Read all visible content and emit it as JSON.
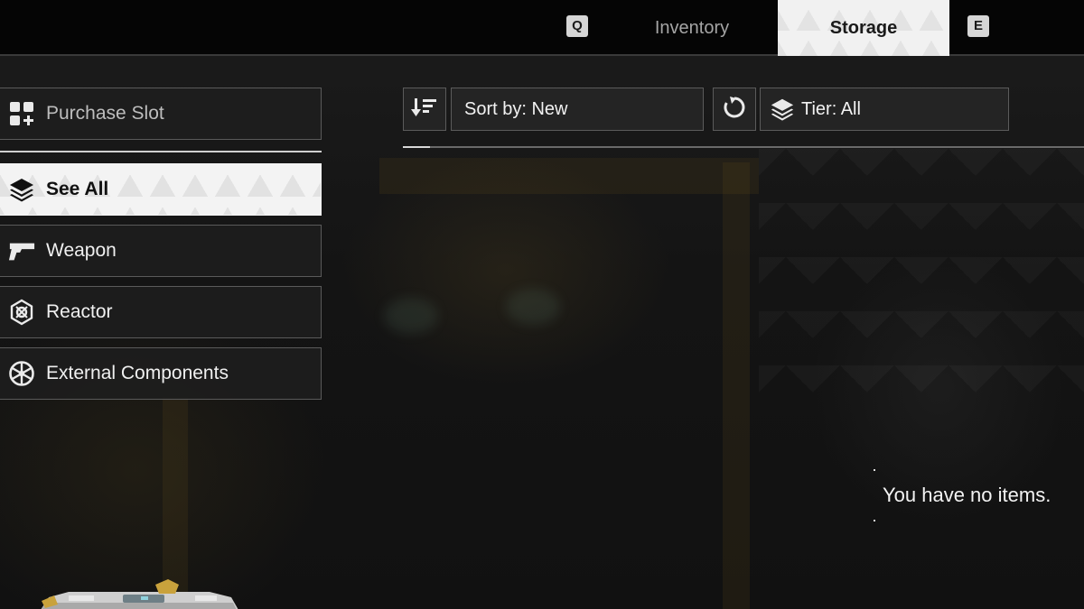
{
  "tabs": {
    "prev_key": "Q",
    "next_key": "E",
    "items": [
      {
        "label": "Inventory",
        "active": false
      },
      {
        "label": "Storage",
        "active": true
      }
    ]
  },
  "menu": {
    "purchase": {
      "label": "Purchase Slot",
      "icon": "grid-plus-icon"
    },
    "categories": [
      {
        "label": "See All",
        "icon": "layers-icon",
        "selected": true
      },
      {
        "label": "Weapon",
        "icon": "pistol-icon",
        "selected": false
      },
      {
        "label": "Reactor",
        "icon": "reactor-icon",
        "selected": false
      },
      {
        "label": "External Components",
        "icon": "gear-wheel-icon",
        "selected": false
      }
    ]
  },
  "toolbar": {
    "sort_order_icon": "sort-descending-icon",
    "sort_label": "Sort by: New",
    "reset_icon": "refresh-icon",
    "tier_icon": "layers-icon",
    "tier_label": "Tier: All"
  },
  "storage": {
    "empty_message": "You have no items."
  },
  "colors": {
    "active_tab_bg": "#f1f1f1",
    "panel_bg": "#1e1e1e",
    "border": "#5a5a5a",
    "text": "#f2f2f2"
  }
}
